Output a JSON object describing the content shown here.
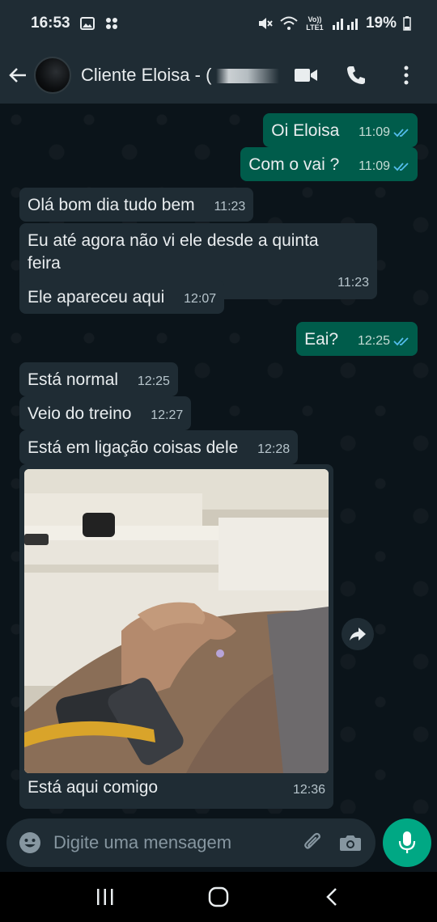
{
  "status_bar": {
    "time": "16:53",
    "battery": "19%",
    "network_label": "Vo)) LTE1",
    "icons": [
      "image-icon",
      "cluster-icon",
      "mute-icon",
      "wifi-icon",
      "signal-icon",
      "battery-icon"
    ]
  },
  "header": {
    "contact_name": "Cliente Eloisa - (",
    "icons": [
      "back-arrow-icon",
      "video-call-icon",
      "phone-icon",
      "more-vert-icon"
    ]
  },
  "messages": [
    {
      "direction": "out",
      "text": "Oi Eloisa",
      "time": "11:09",
      "read": true
    },
    {
      "direction": "out",
      "text": "Com o vai ?",
      "time": "11:09",
      "read": true
    },
    {
      "direction": "in",
      "text": "Olá bom dia tudo bem",
      "time": "11:23"
    },
    {
      "direction": "in",
      "text": "Eu até agora não vi ele desde a quinta feira",
      "time": "11:23"
    },
    {
      "direction": "in",
      "text": "Ele apareceu aqui",
      "time": "12:07"
    },
    {
      "direction": "out",
      "text": "Eai?",
      "time": "12:25",
      "read": true
    },
    {
      "direction": "in",
      "text": "Está normal",
      "time": "12:25"
    },
    {
      "direction": "in",
      "text": "Veio do treino",
      "time": "12:27"
    },
    {
      "direction": "in",
      "text": "Está em ligação coisas dele",
      "time": "12:28"
    }
  ],
  "image_message": {
    "caption": "Está aqui comigo",
    "time": "12:36"
  },
  "input": {
    "placeholder": "Digite uma mensagem",
    "value": ""
  },
  "colors": {
    "background": "#0b141a",
    "bar": "#1f2c34",
    "incoming_bubble": "#1f2c34",
    "outgoing_bubble": "#005c4b",
    "accent": "#00a884",
    "read_tick": "#53bdeb"
  }
}
